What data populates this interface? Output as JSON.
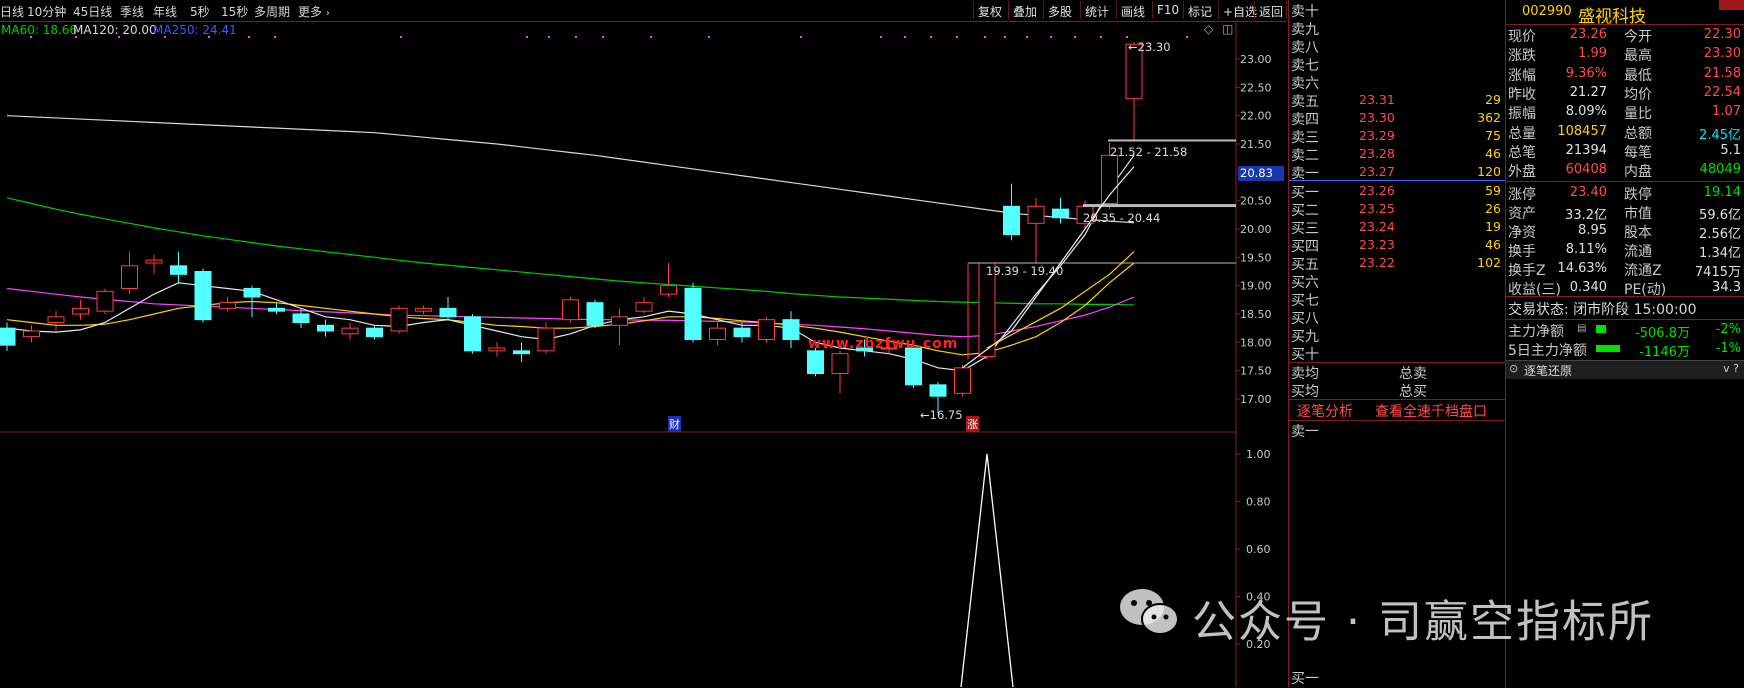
{
  "toolbar": {
    "period_tabs": [
      "日线",
      "10分钟",
      "45日线",
      "季线",
      "年线",
      "5秒",
      "15秒",
      "多周期",
      "更多"
    ],
    "buttons": [
      "复权",
      "叠加",
      "多股",
      "统计",
      "画线",
      "F10",
      "标记",
      "+自选",
      "返回"
    ]
  },
  "ma_legend": {
    "ma60": "MA60: 18.66",
    "ma120": "MA120: 20.00",
    "ma250": "MA250: 24.41"
  },
  "colors": {
    "up": "#ff3c3c",
    "down": "#54ffff",
    "ma5": "#e8e8e8",
    "ma10": "#ffd400",
    "ma20": "#ff44ff",
    "ma60": "#00cc00",
    "ma250": "#d8d8d8",
    "indicator": "#ffffff"
  },
  "price_axis": {
    "ticks": [
      "23.00",
      "22.50",
      "22.00",
      "21.50",
      "21.00",
      "20.50",
      "20.00",
      "19.50",
      "19.00",
      "18.50",
      "18.00",
      "17.50",
      "17.00"
    ],
    "current_tag": "20.83"
  },
  "indicator_axis": {
    "ticks": [
      "1.00",
      "0.80",
      "0.60",
      "0.40",
      "0.20"
    ]
  },
  "annotations": {
    "high": "23.30",
    "low": "16.75",
    "box1": "21.52 - 21.58",
    "box2": "20.35 - 20.44",
    "box3": "19.39 - 19.40",
    "watermark_site": "www.zbzfwu.com",
    "marker_cai": "财",
    "marker_zhang": "涨"
  },
  "chart_data": {
    "type": "candlestick",
    "candles": [
      {
        "o": 18.25,
        "c": 17.95,
        "h": 18.35,
        "l": 17.85
      },
      {
        "o": 18.1,
        "c": 18.2,
        "h": 18.3,
        "l": 18.0
      },
      {
        "o": 18.35,
        "c": 18.45,
        "h": 18.55,
        "l": 18.2
      },
      {
        "o": 18.5,
        "c": 18.6,
        "h": 18.75,
        "l": 18.4
      },
      {
        "o": 18.55,
        "c": 18.9,
        "h": 18.95,
        "l": 18.5
      },
      {
        "o": 18.95,
        "c": 19.35,
        "h": 19.6,
        "l": 18.85
      },
      {
        "o": 19.4,
        "c": 19.45,
        "h": 19.55,
        "l": 19.2
      },
      {
        "o": 19.35,
        "c": 19.2,
        "h": 19.6,
        "l": 19.05
      },
      {
        "o": 19.25,
        "c": 18.4,
        "h": 19.3,
        "l": 18.35
      },
      {
        "o": 18.6,
        "c": 18.7,
        "h": 18.8,
        "l": 18.55
      },
      {
        "o": 18.95,
        "c": 18.8,
        "h": 19.0,
        "l": 18.45
      },
      {
        "o": 18.6,
        "c": 18.55,
        "h": 18.7,
        "l": 18.5
      },
      {
        "o": 18.5,
        "c": 18.35,
        "h": 18.6,
        "l": 18.25
      },
      {
        "o": 18.3,
        "c": 18.2,
        "h": 18.4,
        "l": 18.1
      },
      {
        "o": 18.15,
        "c": 18.25,
        "h": 18.35,
        "l": 18.05
      },
      {
        "o": 18.25,
        "c": 18.1,
        "h": 18.3,
        "l": 18.05
      },
      {
        "o": 18.2,
        "c": 18.6,
        "h": 18.65,
        "l": 18.15
      },
      {
        "o": 18.55,
        "c": 18.6,
        "h": 18.65,
        "l": 18.5
      },
      {
        "o": 18.6,
        "c": 18.45,
        "h": 18.8,
        "l": 18.4
      },
      {
        "o": 18.45,
        "c": 17.85,
        "h": 18.5,
        "l": 17.8
      },
      {
        "o": 17.85,
        "c": 17.9,
        "h": 18.0,
        "l": 17.75
      },
      {
        "o": 17.85,
        "c": 17.8,
        "h": 18.0,
        "l": 17.65
      },
      {
        "o": 17.85,
        "c": 18.25,
        "h": 18.35,
        "l": 17.8
      },
      {
        "o": 18.4,
        "c": 18.75,
        "h": 18.8,
        "l": 18.35
      },
      {
        "o": 18.7,
        "c": 18.3,
        "h": 18.75,
        "l": 18.25
      },
      {
        "o": 18.3,
        "c": 18.45,
        "h": 18.6,
        "l": 17.95
      },
      {
        "o": 18.55,
        "c": 18.7,
        "h": 18.8,
        "l": 18.5
      },
      {
        "o": 18.85,
        "c": 19.0,
        "h": 19.4,
        "l": 18.8
      },
      {
        "o": 18.95,
        "c": 18.05,
        "h": 19.05,
        "l": 18.0
      },
      {
        "o": 18.05,
        "c": 18.25,
        "h": 18.35,
        "l": 17.95
      },
      {
        "o": 18.25,
        "c": 18.1,
        "h": 18.35,
        "l": 18.0
      },
      {
        "o": 18.05,
        "c": 18.4,
        "h": 18.45,
        "l": 18.0
      },
      {
        "o": 18.4,
        "c": 18.05,
        "h": 18.55,
        "l": 17.9
      },
      {
        "o": 17.85,
        "c": 17.45,
        "h": 17.9,
        "l": 17.4
      },
      {
        "o": 17.45,
        "c": 17.8,
        "h": 17.85,
        "l": 17.1
      },
      {
        "o": 17.9,
        "c": 17.85,
        "h": 18.05,
        "l": 17.75
      },
      {
        "o": 17.9,
        "c": 17.9,
        "h": 18.0,
        "l": 17.8
      },
      {
        "o": 17.9,
        "c": 17.25,
        "h": 17.95,
        "l": 17.2
      },
      {
        "o": 17.25,
        "c": 17.05,
        "h": 17.3,
        "l": 16.75
      },
      {
        "o": 17.1,
        "c": 17.55,
        "h": 17.6,
        "l": 17.05
      },
      {
        "o": 17.75,
        "c": 19.4,
        "h": 19.4,
        "l": 17.7
      },
      {
        "o": 20.4,
        "c": 19.9,
        "h": 20.8,
        "l": 19.8
      },
      {
        "o": 20.1,
        "c": 20.4,
        "h": 20.55,
        "l": 19.4
      },
      {
        "o": 20.35,
        "c": 20.2,
        "h": 20.55,
        "l": 20.1
      },
      {
        "o": 20.1,
        "c": 20.4,
        "h": 20.5,
        "l": 20.0
      },
      {
        "o": 20.45,
        "c": 21.3,
        "h": 21.52,
        "l": 20.35
      },
      {
        "o": 22.3,
        "c": 23.26,
        "h": 23.3,
        "l": 21.58
      }
    ],
    "ma5": [
      18.25,
      18.2,
      18.18,
      18.22,
      18.35,
      18.6,
      18.85,
      19.05,
      19.0,
      18.95,
      18.9,
      18.75,
      18.6,
      18.45,
      18.4,
      18.3,
      18.28,
      18.35,
      18.4,
      18.3,
      18.2,
      18.1,
      18.05,
      18.15,
      18.3,
      18.4,
      18.45,
      18.55,
      18.5,
      18.4,
      18.3,
      18.3,
      18.25,
      18.0,
      17.9,
      17.85,
      17.8,
      17.7,
      17.55,
      17.5,
      17.75,
      18.3,
      18.85,
      19.35,
      19.9,
      20.7,
      21.3
    ],
    "ma10": [
      18.4,
      18.35,
      18.3,
      18.3,
      18.32,
      18.4,
      18.5,
      18.6,
      18.65,
      18.7,
      18.72,
      18.7,
      18.65,
      18.6,
      18.55,
      18.5,
      18.45,
      18.42,
      18.4,
      18.35,
      18.3,
      18.28,
      18.25,
      18.25,
      18.28,
      18.32,
      18.38,
      18.45,
      18.45,
      18.42,
      18.38,
      18.35,
      18.3,
      18.25,
      18.18,
      18.1,
      18.02,
      17.95,
      17.85,
      17.78,
      17.82,
      17.95,
      18.1,
      18.35,
      18.65,
      19.05,
      19.4
    ],
    "ma20": [
      18.95,
      18.9,
      18.85,
      18.8,
      18.76,
      18.72,
      18.68,
      18.66,
      18.64,
      18.62,
      18.6,
      18.58,
      18.56,
      18.54,
      18.52,
      18.5,
      18.48,
      18.47,
      18.46,
      18.45,
      18.44,
      18.43,
      18.42,
      18.41,
      18.4,
      18.4,
      18.39,
      18.39,
      18.38,
      18.37,
      18.36,
      18.34,
      18.32,
      18.3,
      18.27,
      18.24,
      18.2,
      18.16,
      18.12,
      18.1,
      18.12,
      18.2,
      18.28,
      18.38,
      18.48,
      18.62,
      18.8
    ],
    "ma60": [
      20.55,
      20.45,
      20.35,
      20.26,
      20.18,
      20.1,
      20.02,
      19.95,
      19.88,
      19.82,
      19.76,
      19.7,
      19.65,
      19.6,
      19.55,
      19.5,
      19.45,
      19.4,
      19.36,
      19.32,
      19.28,
      19.24,
      19.2,
      19.16,
      19.12,
      19.08,
      19.05,
      19.02,
      18.99,
      18.96,
      18.93,
      18.9,
      18.86,
      18.83,
      18.8,
      18.78,
      18.76,
      18.74,
      18.72,
      18.71,
      18.7,
      18.69,
      18.68,
      18.68,
      18.67,
      18.67,
      18.66
    ],
    "ma250": [
      22.0,
      21.98,
      21.96,
      21.94,
      21.92,
      21.9,
      21.88,
      21.86,
      21.84,
      21.82,
      21.8,
      21.78,
      21.76,
      21.74,
      21.72,
      21.7,
      21.66,
      21.62,
      21.58,
      21.54,
      21.5,
      21.45,
      21.4,
      21.35,
      21.3,
      21.24,
      21.18,
      21.12,
      21.06,
      21.0,
      20.94,
      20.88,
      20.82,
      20.76,
      20.7,
      20.64,
      20.58,
      20.52,
      20.46,
      20.4,
      20.34,
      20.28,
      20.24,
      20.2,
      20.17,
      20.14,
      20.11
    ],
    "indicator_spike": {
      "index": 40,
      "value": 1.0
    },
    "price_range": [
      16.5,
      23.5
    ],
    "indicator_range": [
      0,
      1.05
    ]
  },
  "order_book": {
    "sell": [
      {
        "label": "卖十",
        "price": "",
        "vol": ""
      },
      {
        "label": "卖九",
        "price": "",
        "vol": ""
      },
      {
        "label": "卖八",
        "price": "",
        "vol": ""
      },
      {
        "label": "卖七",
        "price": "",
        "vol": ""
      },
      {
        "label": "卖六",
        "price": "",
        "vol": ""
      },
      {
        "label": "卖五",
        "price": "23.31",
        "vol": "29"
      },
      {
        "label": "卖四",
        "price": "23.30",
        "vol": "362"
      },
      {
        "label": "卖三",
        "price": "23.29",
        "vol": "75"
      },
      {
        "label": "卖二",
        "price": "23.28",
        "vol": "46"
      },
      {
        "label": "卖一",
        "price": "23.27",
        "vol": "120"
      }
    ],
    "buy": [
      {
        "label": "买一",
        "price": "23.26",
        "vol": "59"
      },
      {
        "label": "买二",
        "price": "23.25",
        "vol": "26"
      },
      {
        "label": "买三",
        "price": "23.24",
        "vol": "19"
      },
      {
        "label": "买四",
        "price": "23.23",
        "vol": "46"
      },
      {
        "label": "买五",
        "price": "23.22",
        "vol": "102"
      },
      {
        "label": "买六",
        "price": "",
        "vol": ""
      },
      {
        "label": "买七",
        "price": "",
        "vol": ""
      },
      {
        "label": "买八",
        "price": "",
        "vol": ""
      },
      {
        "label": "买九",
        "price": "",
        "vol": ""
      },
      {
        "label": "买十",
        "price": "",
        "vol": ""
      }
    ],
    "avg_sell": "卖均",
    "avg_buy": "买均",
    "total_sell": "总卖",
    "total_buy": "总买",
    "link_tick": "逐笔分析",
    "link_depth": "查看全速千档盘口",
    "bottom_sell1": "卖一",
    "bottom_buy1": "买一"
  },
  "quote": {
    "code": "002990",
    "name": "盛视科技",
    "rows": [
      {
        "l1": "现价",
        "v1": "23.26",
        "c1": "red",
        "l2": "今开",
        "v2": "22.30",
        "c2": "red"
      },
      {
        "l1": "涨跌",
        "v1": "1.99",
        "c1": "red",
        "l2": "最高",
        "v2": "23.30",
        "c2": "red"
      },
      {
        "l1": "涨幅",
        "v1": "9.36%",
        "c1": "red",
        "l2": "最低",
        "v2": "21.58",
        "c2": "red"
      },
      {
        "l1": "昨收",
        "v1": "21.27",
        "c1": "white",
        "l2": "均价",
        "v2": "22.54",
        "c2": "red"
      },
      {
        "l1": "振幅",
        "v1": "8.09%",
        "c1": "white",
        "l2": "量比",
        "v2": "1.07",
        "c2": "red"
      },
      {
        "l1": "总量",
        "v1": "108457",
        "c1": "yellow",
        "l2": "总额",
        "v2": "2.45亿",
        "c2": "cyan"
      },
      {
        "l1": "总笔",
        "v1": "21394",
        "c1": "white",
        "l2": "每笔",
        "v2": "5.1",
        "c2": "white"
      },
      {
        "l1": "外盘",
        "v1": "60408",
        "c1": "red",
        "l2": "内盘",
        "v2": "48049",
        "c2": "green"
      },
      {
        "l1": "涨停",
        "v1": "23.40",
        "c1": "red",
        "l2": "跌停",
        "v2": "19.14",
        "c2": "green"
      },
      {
        "l1": "资产",
        "v1": "33.2亿",
        "c1": "white",
        "l2": "市值",
        "v2": "59.6亿",
        "c2": "white"
      },
      {
        "l1": "净资",
        "v1": "8.95",
        "c1": "white",
        "l2": "股本",
        "v2": "2.56亿",
        "c2": "white"
      },
      {
        "l1": "换手",
        "v1": "8.11%",
        "c1": "white",
        "l2": "流通",
        "v2": "1.34亿",
        "c2": "white"
      },
      {
        "l1": "换手Z",
        "v1": "14.63%",
        "c1": "white",
        "l2": "流通Z",
        "v2": "7415万",
        "c2": "white"
      },
      {
        "l1": "收益(三)",
        "v1": "0.340",
        "c1": "white",
        "l2": "PE(动)",
        "v2": "34.3",
        "c2": "white"
      }
    ],
    "trade_status": "交易状态: 闭市阶段 15:00:00",
    "main_flow_label": "主力净额",
    "main_flow_value": "-506.8万",
    "main_flow_pct": "-2%",
    "flow5_label": "5日主力净额",
    "flow5_value": "-1146万",
    "flow5_pct": "-1%",
    "tick_restore": "逐笔还原",
    "tick_restore_icons": "ⅴ ?"
  },
  "watermark": "公众号 · 司赢空指标所"
}
